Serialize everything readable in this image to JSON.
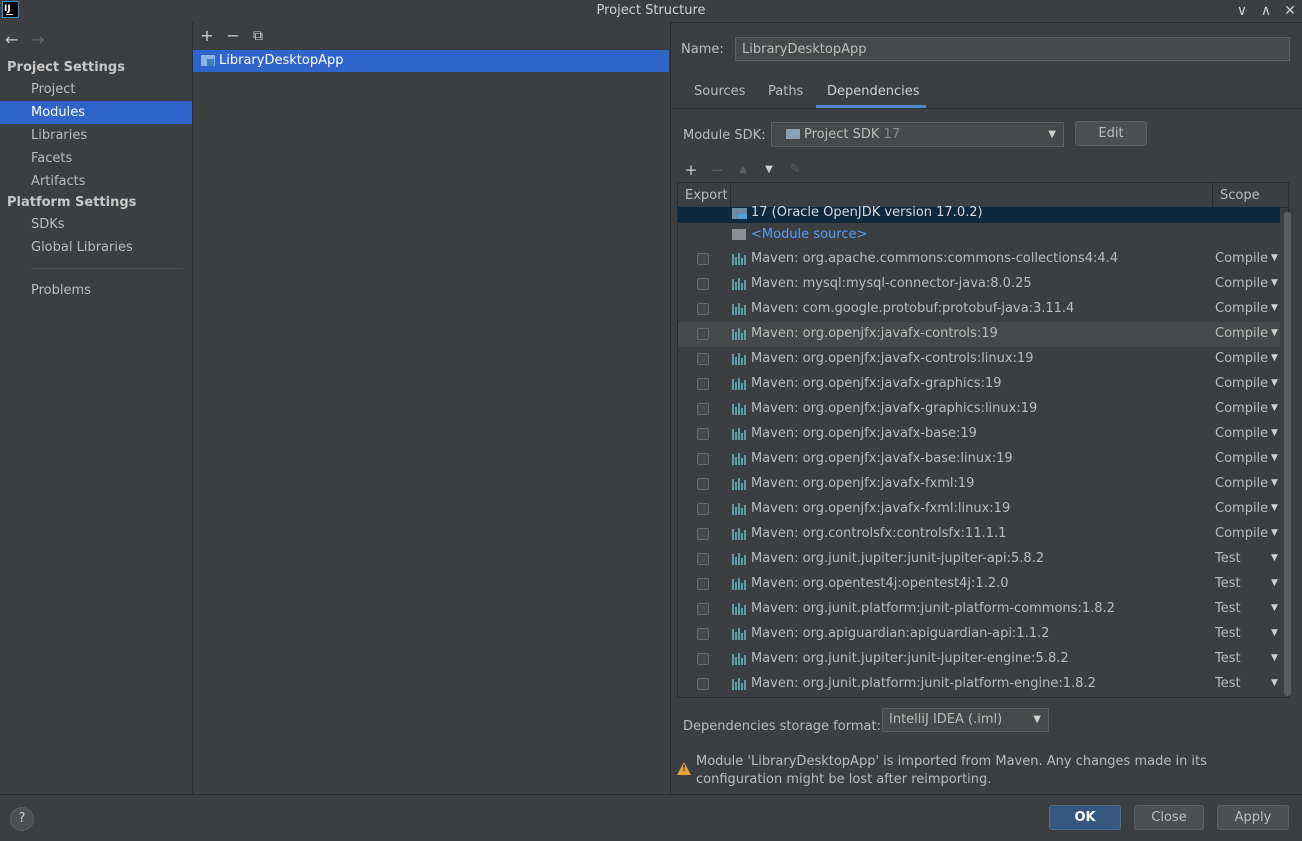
{
  "window": {
    "title": "Project Structure",
    "logo_text": "IJ",
    "controls": {
      "minimize": "∨",
      "maximize": "∧",
      "close": "✕"
    }
  },
  "nav": {
    "back_icon": "←",
    "forward_icon": "→",
    "project_settings_header": "Project Settings",
    "project_items": [
      "Project",
      "Modules",
      "Libraries",
      "Facets",
      "Artifacts"
    ],
    "platform_settings_header": "Platform Settings",
    "platform_items": [
      "SDKs",
      "Global Libraries"
    ],
    "problems": "Problems",
    "selected": "Modules"
  },
  "modules": {
    "toolbar": {
      "add": "+",
      "remove": "−",
      "copy": "⧉"
    },
    "items": [
      "LibraryDesktopApp"
    ]
  },
  "module": {
    "name_label": "Name:",
    "name_value": "LibraryDesktopApp",
    "tabs": [
      "Sources",
      "Paths",
      "Dependencies"
    ],
    "active_tab": "Dependencies",
    "sdk_label": "Module SDK:",
    "sdk_value": "Project SDK",
    "sdk_version": "17",
    "edit_label": "Edit"
  },
  "deps": {
    "toolbar": {
      "add": "+",
      "remove": "−",
      "up": "▲",
      "down": "▼",
      "edit": "✎"
    },
    "col_export": "Export",
    "col_scope": "Scope",
    "sdk_row": "17 (Oracle OpenJDK version 17.0.2)",
    "source_row": "<Module source>",
    "rows": [
      {
        "name": "Maven: org.apache.commons:commons-collections4:4.4",
        "scope": "Compile"
      },
      {
        "name": "Maven: mysql:mysql-connector-java:8.0.25",
        "scope": "Compile"
      },
      {
        "name": "Maven: com.google.protobuf:protobuf-java:3.11.4",
        "scope": "Compile"
      },
      {
        "name": "Maven: org.openjfx:javafx-controls:19",
        "scope": "Compile"
      },
      {
        "name": "Maven: org.openjfx:javafx-controls:linux:19",
        "scope": "Compile"
      },
      {
        "name": "Maven: org.openjfx:javafx-graphics:19",
        "scope": "Compile"
      },
      {
        "name": "Maven: org.openjfx:javafx-graphics:linux:19",
        "scope": "Compile"
      },
      {
        "name": "Maven: org.openjfx:javafx-base:19",
        "scope": "Compile"
      },
      {
        "name": "Maven: org.openjfx:javafx-base:linux:19",
        "scope": "Compile"
      },
      {
        "name": "Maven: org.openjfx:javafx-fxml:19",
        "scope": "Compile"
      },
      {
        "name": "Maven: org.openjfx:javafx-fxml:linux:19",
        "scope": "Compile"
      },
      {
        "name": "Maven: org.controlsfx:controlsfx:11.1.1",
        "scope": "Compile"
      },
      {
        "name": "Maven: org.junit.jupiter:junit-jupiter-api:5.8.2",
        "scope": "Test"
      },
      {
        "name": "Maven: org.opentest4j:opentest4j:1.2.0",
        "scope": "Test"
      },
      {
        "name": "Maven: org.junit.platform:junit-platform-commons:1.8.2",
        "scope": "Test"
      },
      {
        "name": "Maven: org.apiguardian:apiguardian-api:1.1.2",
        "scope": "Test"
      },
      {
        "name": "Maven: org.junit.jupiter:junit-jupiter-engine:5.8.2",
        "scope": "Test"
      },
      {
        "name": "Maven: org.junit.platform:junit-platform-engine:1.8.2",
        "scope": "Test"
      }
    ],
    "storage_label": "Dependencies storage format:",
    "storage_value": "IntelliJ IDEA (.iml)",
    "warning": "Module 'LibraryDesktopApp' is imported from Maven. Any changes made in its configuration might be lost after reimporting."
  },
  "footer": {
    "help": "?",
    "ok": "OK",
    "close": "Close",
    "apply": "Apply"
  },
  "colors": {
    "background": "#3c3f41",
    "selection": "#2f65ca",
    "accent_tab": "#4a88c7",
    "ok_button": "#365880",
    "warning": "#e8a33d",
    "link": "#589df6"
  }
}
